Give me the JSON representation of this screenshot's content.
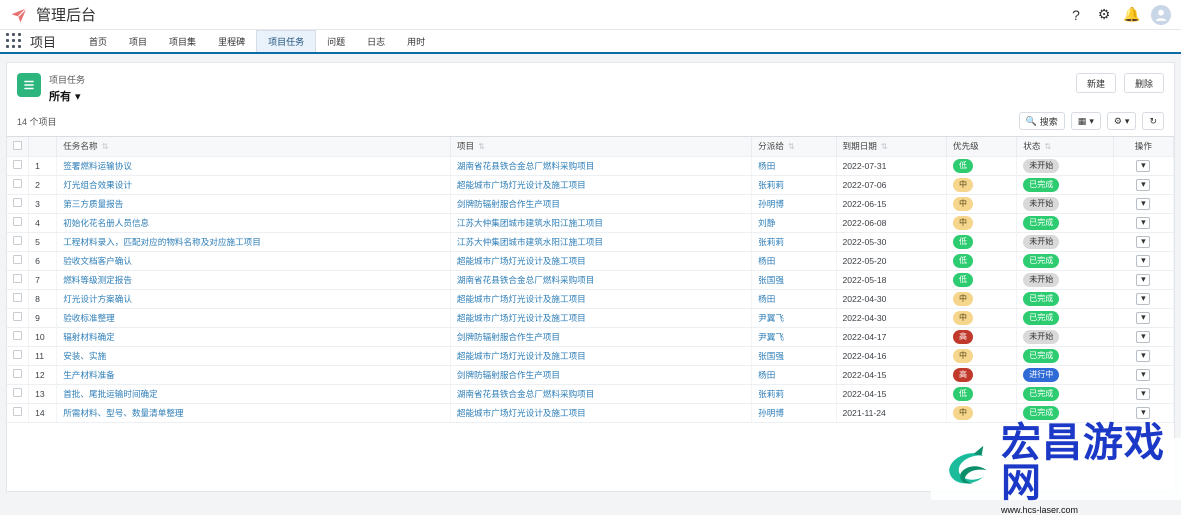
{
  "topbar": {
    "title": "管理后台",
    "icons": {
      "logo": "paper-plane-icon",
      "help": "help-icon",
      "settings": "gear-icon",
      "notifications": "bell-icon",
      "avatar": "user-avatar"
    }
  },
  "nav": {
    "app_name": "项目",
    "tabs": [
      {
        "label": "首页"
      },
      {
        "label": "项目"
      },
      {
        "label": "项目集"
      },
      {
        "label": "里程碑"
      },
      {
        "label": "项目任务"
      },
      {
        "label": "问题"
      },
      {
        "label": "日志"
      },
      {
        "label": "用时"
      }
    ],
    "active_tab_index": 4
  },
  "page": {
    "subtitle": "项目任务",
    "title": "所有",
    "count_text": "14 个项目",
    "buttons": {
      "new": "新建",
      "delete": "删除"
    },
    "tools": {
      "search_label": "搜索"
    }
  },
  "table": {
    "headers": [
      "任务名称",
      "项目",
      "分派给",
      "到期日期",
      "优先级",
      "状态",
      "操作"
    ],
    "rows": [
      {
        "no": "1",
        "task": "签署燃料运输协议",
        "project": "湖南省花县铁合金总厂燃料采购项目",
        "assignee": "杨田",
        "due": "2022-07-31",
        "priority": "低",
        "status": "未开始"
      },
      {
        "no": "2",
        "task": "灯光组合效果设计",
        "project": "超能城市广场灯光设计及施工项目",
        "assignee": "张莉莉",
        "due": "2022-07-06",
        "priority": "中",
        "status": "已完成"
      },
      {
        "no": "3",
        "task": "第三方质量报告",
        "project": "剑牌防辐射服合作生产项目",
        "assignee": "孙明博",
        "due": "2022-06-15",
        "priority": "中",
        "status": "未开始"
      },
      {
        "no": "4",
        "task": "初始化花名册人员信息",
        "project": "江苏大仲集团城市建筑水阳江施工项目",
        "assignee": "刘静",
        "due": "2022-06-08",
        "priority": "中",
        "status": "已完成"
      },
      {
        "no": "5",
        "task": "工程材料录入，匹配对应的物料名称及对应施工项目",
        "project": "江苏大仲集团城市建筑水阳江施工项目",
        "assignee": "张莉莉",
        "due": "2022-05-30",
        "priority": "低",
        "status": "未开始"
      },
      {
        "no": "6",
        "task": "验收文档客户确认",
        "project": "超能城市广场灯光设计及施工项目",
        "assignee": "杨田",
        "due": "2022-05-20",
        "priority": "低",
        "status": "已完成"
      },
      {
        "no": "7",
        "task": "燃料等级测定报告",
        "project": "湖南省花县铁合金总厂燃料采购项目",
        "assignee": "张国强",
        "due": "2022-05-18",
        "priority": "低",
        "status": "未开始"
      },
      {
        "no": "8",
        "task": "灯光设计方案确认",
        "project": "超能城市广场灯光设计及施工项目",
        "assignee": "杨田",
        "due": "2022-04-30",
        "priority": "中",
        "status": "已完成"
      },
      {
        "no": "9",
        "task": "验收标准整理",
        "project": "超能城市广场灯光设计及施工项目",
        "assignee": "尹翼飞",
        "due": "2022-04-30",
        "priority": "中",
        "status": "已完成"
      },
      {
        "no": "10",
        "task": "辐射材料确定",
        "project": "剑牌防辐射服合作生产项目",
        "assignee": "尹翼飞",
        "due": "2022-04-17",
        "priority": "高",
        "status": "未开始"
      },
      {
        "no": "11",
        "task": "安装、实施",
        "project": "超能城市广场灯光设计及施工项目",
        "assignee": "张国强",
        "due": "2022-04-16",
        "priority": "中",
        "status": "已完成"
      },
      {
        "no": "12",
        "task": "生产材料准备",
        "project": "剑牌防辐射服合作生产项目",
        "assignee": "杨田",
        "due": "2022-04-15",
        "priority": "高",
        "status": "进行中"
      },
      {
        "no": "13",
        "task": "首批、尾批运输时间确定",
        "project": "湖南省花县铁合金总厂燃料采购项目",
        "assignee": "张莉莉",
        "due": "2022-04-15",
        "priority": "低",
        "status": "已完成"
      },
      {
        "no": "14",
        "task": "所需材料、型号、数量清单整理",
        "project": "超能城市广场灯光设计及施工项目",
        "assignee": "孙明博",
        "due": "2021-11-24",
        "priority": "中",
        "status": "已完成"
      }
    ]
  },
  "watermark": {
    "title": "宏昌游戏网",
    "url": "www.hcs-laser.com"
  }
}
